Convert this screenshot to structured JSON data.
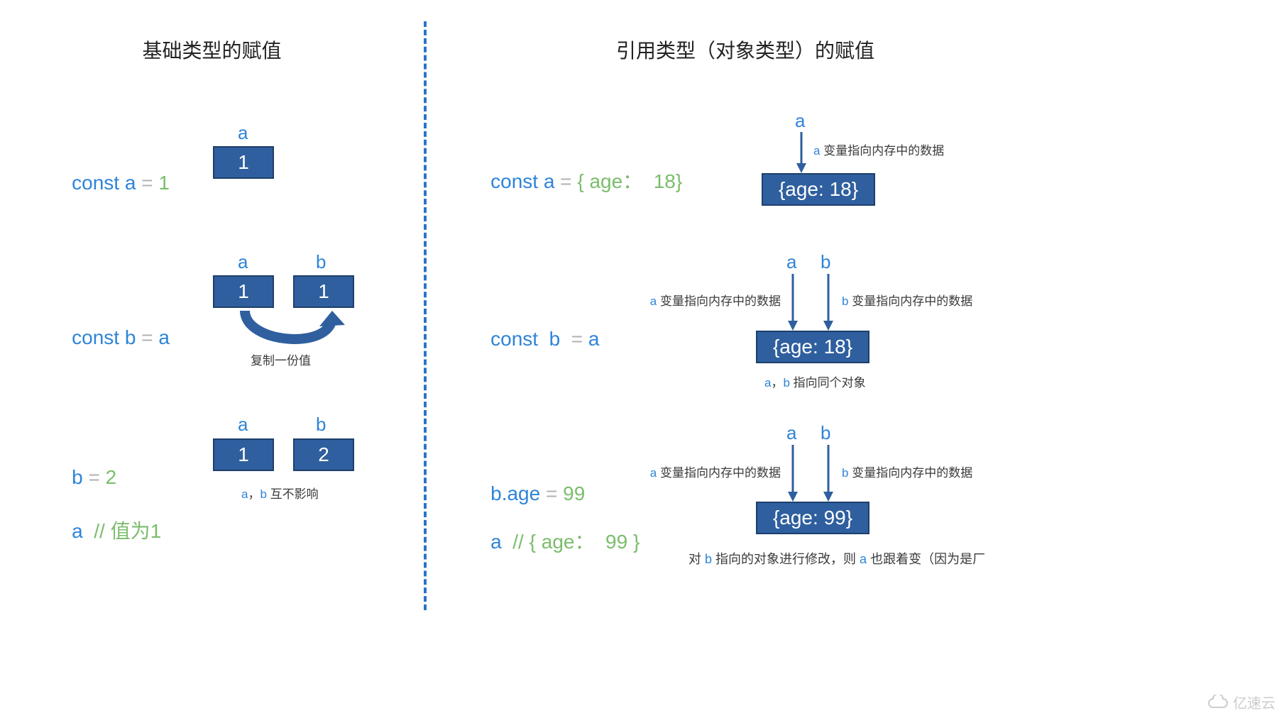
{
  "left": {
    "title": "基础类型的赋值",
    "row1": {
      "code": {
        "const": "const ",
        "a": "a",
        "eq": " = ",
        "val": "1"
      },
      "label_a": "a",
      "box_a": "1"
    },
    "row2": {
      "code": {
        "const": "const ",
        "b": "b",
        "eq": " = ",
        "rhs": "a"
      },
      "label_a": "a",
      "label_b": "b",
      "box_a": "1",
      "box_b": "1",
      "note": "复制一份值"
    },
    "row3": {
      "code1": {
        "b": "b",
        "eq": " = ",
        "val": "2"
      },
      "code2": {
        "a": "a",
        "comment": "  // ",
        "msg": "值为1"
      },
      "label_a": "a",
      "label_b": "b",
      "box_a": "1",
      "box_b": "2",
      "note_prefix": "a",
      "note_sep": "，",
      "note_b": "b",
      "note_suffix": " 互不影响"
    }
  },
  "right": {
    "title": "引用类型（对象类型）的赋值",
    "row1": {
      "code": {
        "const": "const ",
        "a": "a",
        "eq": " = ",
        "val": "{ age：  18}"
      },
      "label_a": "a",
      "arrow_text": " 变量指向内存中的数据",
      "box": "{age: 18}"
    },
    "row2": {
      "code": {
        "const": "const  ",
        "b": "b",
        "eq": "  = ",
        "rhs": "a"
      },
      "label_a": "a",
      "label_b": "b",
      "arrow_a": " 变量指向内存中的数据",
      "arrow_b": " 变量指向内存中的数据",
      "box": "{age: 18}",
      "note_prefix": "a",
      "note_sep": "，",
      "note_b": "b",
      "note_suffix": " 指向同个对象"
    },
    "row3": {
      "code1": {
        "b": "b.age",
        "eq": " = ",
        "val": "99"
      },
      "code2": {
        "a": "a",
        "comment": "  // ",
        "msg": "{ age：  99 }"
      },
      "label_a": "a",
      "label_b": "b",
      "arrow_a": " 变量指向内存中的数据",
      "arrow_b": " 变量指向内存中的数据",
      "box": "{age: 99}",
      "footer_1": "对 ",
      "footer_b": "b",
      "footer_2": " 指向的对象进行修改，则 ",
      "footer_a": "a",
      "footer_3": " 也跟着变（因为是厂"
    }
  },
  "watermark": "亿速云"
}
